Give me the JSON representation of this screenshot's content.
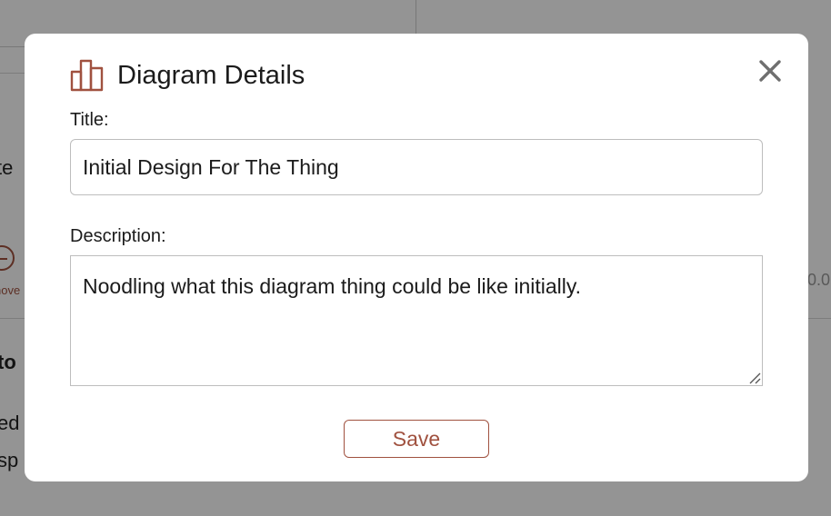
{
  "modal": {
    "title": "Diagram Details",
    "close_icon": "close-icon",
    "header_icon": "bar-chart-icon",
    "accent_color": "#a0513f",
    "title_label": "Title:",
    "title_value": "Initial Design For The Thing",
    "description_label": "Description:",
    "description_value": "Noodling what this diagram thing could be like initially.",
    "save_label": "Save"
  },
  "background": {
    "fragments": [
      "te",
      "to",
      "ed",
      "sp"
    ],
    "remove_label": "nove",
    "number_fragment": "0.0"
  }
}
